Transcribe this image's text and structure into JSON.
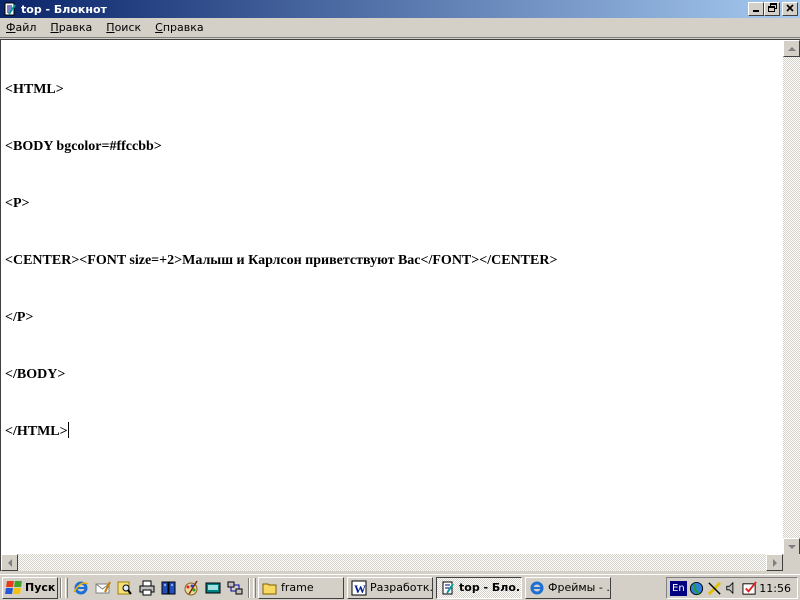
{
  "window": {
    "title": "top - Блокнот",
    "minimize_label": "_",
    "maximize_label": "▭",
    "close_label": "✕"
  },
  "menu": [
    {
      "label": "Файл",
      "accel": "Ф",
      "rest": "айл"
    },
    {
      "label": "Правка",
      "accel": "П",
      "rest": "равка"
    },
    {
      "label": "Поиск",
      "accel": "П",
      "rest": "оиск"
    },
    {
      "label": "Справка",
      "accel": "С",
      "rest": "правка"
    }
  ],
  "document": {
    "lines": [
      "<HTML>",
      "<BODY bgcolor=#ffccbb>",
      "<P>",
      "<CENTER><FONT size=+2>Малыш и Карлсон приветствуют Вас</FONT></CENTER>",
      "</P>",
      "</BODY>",
      "</HTML>"
    ]
  },
  "taskbar": {
    "start_label": "Пуск",
    "quick_launch": [
      "internet-explorer-icon",
      "outlook-express-icon",
      "search-icon",
      "printer-icon",
      "books-icon",
      "paint-icon",
      "keyboard-icon",
      "network-icon"
    ],
    "tasks": [
      {
        "label": "frame",
        "icon": "folder-icon",
        "active": false
      },
      {
        "label": "Разработк...",
        "icon": "word-icon",
        "active": false
      },
      {
        "label": "top - Бло...",
        "icon": "notepad-icon",
        "active": true
      },
      {
        "label": "Фреймы - ...",
        "icon": "internet-explorer-icon",
        "active": false
      }
    ],
    "tray": {
      "language": "En",
      "clock": "11:56"
    }
  },
  "colors": {
    "title_start": "#0a246a",
    "title_end": "#a6caf0",
    "face": "#d4d0c8",
    "editor_bg": "#ffffff"
  }
}
